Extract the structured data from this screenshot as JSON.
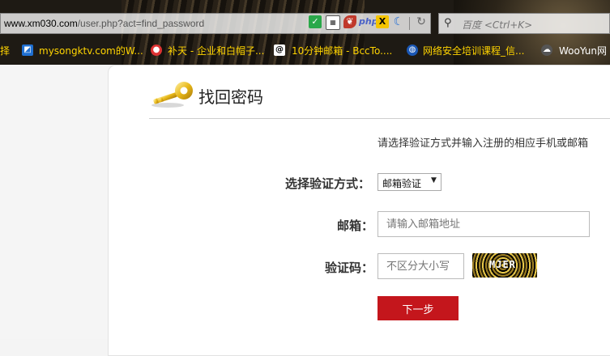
{
  "browser": {
    "url_host": "www.xm030.com",
    "url_path": "/user.php?act=find_password",
    "extensions": {
      "shield": "✓",
      "php": "php",
      "x": "X"
    },
    "search_placeholder": "百度 <Ctrl+K>",
    "bookmarks": [
      {
        "label": "择",
        "icon": ""
      },
      {
        "label": "mysongktv.com的W...",
        "icon": "mysongktv-icon"
      },
      {
        "label": "补天 - 企业和白帽子...",
        "icon": "butian-icon"
      },
      {
        "label": "10分钟邮箱 - BccTo....",
        "icon": "at-icon"
      },
      {
        "label": "网络安全培训课程_信...",
        "icon": "globe-icon"
      },
      {
        "label": "WooYun网",
        "icon": "wooyun-icon"
      }
    ]
  },
  "page": {
    "title": "找回密码",
    "hint": "请选择验证方式并输入注册的相应手机或邮箱",
    "method_label": "选择验证方式：",
    "method_selected": "邮箱验证",
    "email_label": "邮箱：",
    "email_placeholder": "请输入邮箱地址",
    "captcha_label": "验证码：",
    "captcha_placeholder": "不区分大小写",
    "captcha_text": "MJER",
    "next_label": "下一步"
  },
  "colors": {
    "accent": "#c4161c",
    "bookmark_text": "#ffd400"
  }
}
